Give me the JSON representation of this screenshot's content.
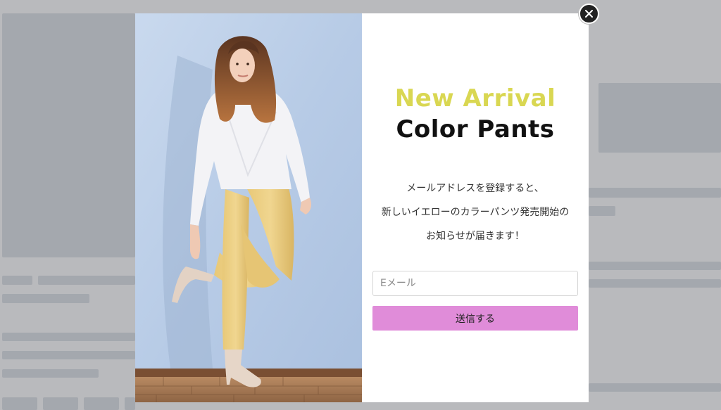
{
  "popup": {
    "headline": "New Arrival",
    "subheadline": "Color Pants",
    "message_lines": [
      "メールアドレスを登録すると、",
      "新しいイエローのカラーパンツ発売開始の",
      "お知らせが届きます！"
    ],
    "email_placeholder": "Eメール",
    "submit_label": "送信する",
    "close_icon": "close-icon",
    "image": "woman-in-yellow-pants-photo"
  },
  "colors": {
    "headline": "#d9d752",
    "subheadline": "#111111",
    "submit_button": "#e08cd9",
    "overlay": "#b9babd"
  }
}
